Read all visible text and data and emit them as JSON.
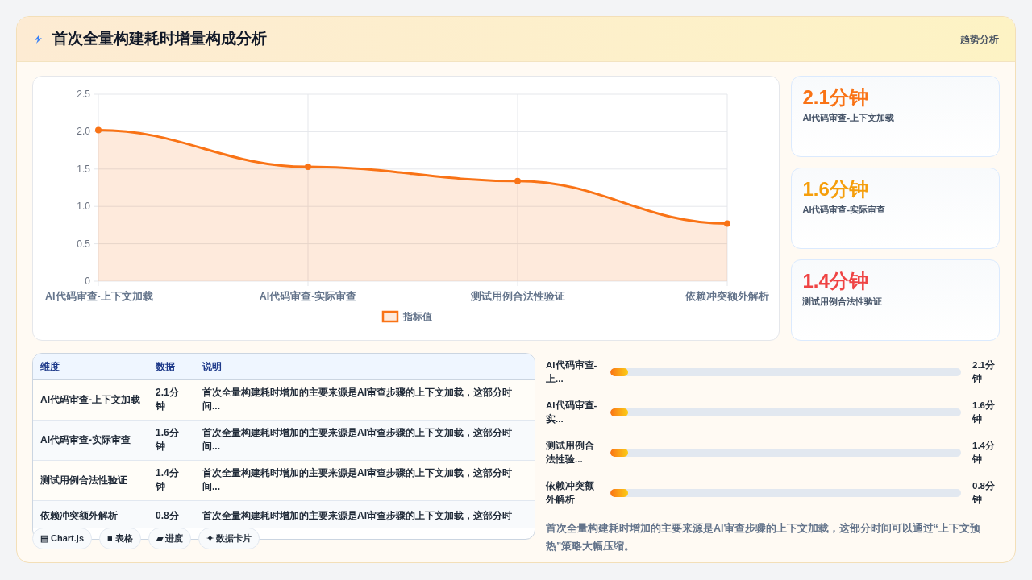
{
  "header": {
    "title": "首次全量构建耗时增量构成分析",
    "action": "趋势分析"
  },
  "chart": {
    "chart_data": {
      "type": "area",
      "categories": [
        "AI代码审查-上下文加载",
        "AI代码审查-实际审查",
        "测试用例合法性验证",
        "依赖冲突额外解析"
      ],
      "series": [
        {
          "name": "指标值",
          "color": "#f97316",
          "values": [
            2.02,
            1.53,
            1.34,
            0.77
          ]
        }
      ],
      "ylim": [
        0,
        2.5
      ],
      "yticks": [
        0,
        0.5,
        {
          "value": 1,
          "label": "1.0"
        },
        1.5,
        {
          "value": 2,
          "label": "2.0"
        },
        2.5
      ],
      "grid": true
    }
  },
  "stat_cards": [
    {
      "value": "2.1分钟",
      "label": "AI代码审查-上下文加载",
      "color": "#f97316"
    },
    {
      "value": "1.6分钟",
      "label": "AI代码审查-实际审查",
      "color": "#f59e0b"
    },
    {
      "value": "1.4分钟",
      "label": "测试用例合法性验证",
      "color": "#ef4444"
    }
  ],
  "table": {
    "columns": [
      "维度",
      "数据",
      "说明"
    ],
    "rows": [
      [
        "AI代码审查-上下文加载",
        "2.1分钟",
        "首次全量构建耗时增加的主要来源是AI审查步骤的上下文加载，这部分时间..."
      ],
      [
        "AI代码审查-实际审查",
        "1.6分钟",
        "首次全量构建耗时增加的主要来源是AI审查步骤的上下文加载，这部分时间..."
      ],
      [
        "测试用例合法性验证",
        "1.4分钟",
        "首次全量构建耗时增加的主要来源是AI审查步骤的上下文加载，这部分时间..."
      ],
      [
        "依赖冲突额外解析",
        "0.8分",
        "首次全量构建耗时增加的主要来源是AI审查步骤的上下文加载，这部分时"
      ]
    ]
  },
  "view_tabs": [
    {
      "icon": "▤",
      "label": "Chart.js"
    },
    {
      "icon": "■",
      "label": "表格"
    },
    {
      "icon": "▰",
      "label": "进度"
    },
    {
      "icon": "✦",
      "label": "数据卡片"
    }
  ],
  "progress": [
    {
      "label": "AI代码审查-上...",
      "level": 0.05,
      "reading": "2.1分钟"
    },
    {
      "label": "AI代码审查-实...",
      "level": 0.05,
      "reading": "1.6分钟"
    },
    {
      "label": "测试用例合法性验...",
      "level": 0.05,
      "reading": "1.4分钟"
    },
    {
      "label": "依赖冲突额外解析",
      "level": 0.05,
      "reading": "0.8分钟"
    }
  ],
  "summary": "首次全量构建耗时增加的主要来源是AI审查步骤的上下文加载，这部分时间可以通过“上下文预热”策略大幅压缩。"
}
